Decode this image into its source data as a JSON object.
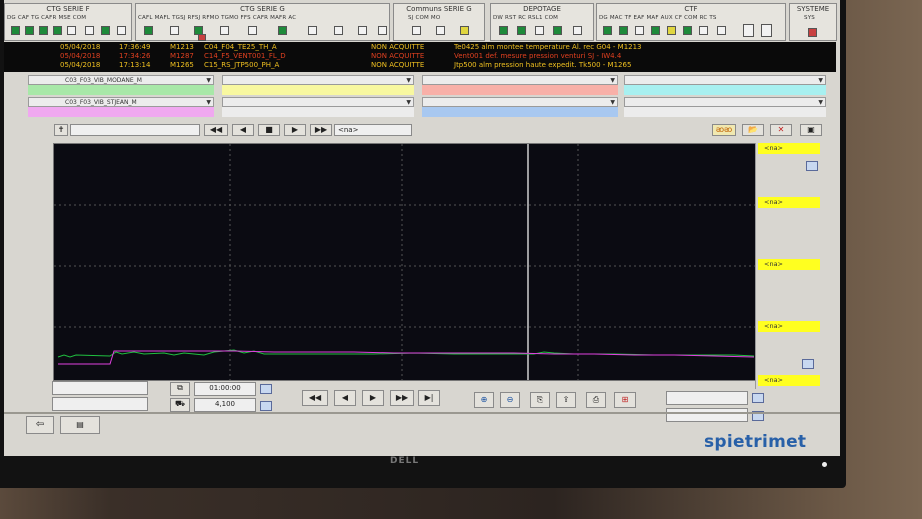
{
  "header": {
    "groups": [
      {
        "title": "CTG SERIE F",
        "labels": "DG CAF TG CAFR MSE COM"
      },
      {
        "title": "CTG SERIE G",
        "labels": "CAFL MAFL TGSJ RFSJ RFMO TGMO FFS CAFR MAFR AC"
      },
      {
        "title": "Communs SERIE G",
        "labels": "SJ   COM   MO"
      },
      {
        "title": "DEPOTAGE",
        "labels": "DW RST RC RSL1 COM"
      },
      {
        "title": "CTF",
        "labels": "DG MAC TF EAF MAF AUX CF COM RC TS"
      },
      {
        "title": "SYSTEME",
        "labels": "SYS"
      }
    ]
  },
  "alarms": [
    {
      "date": "05/04/2018",
      "time": "17:36:49",
      "code": "M1213",
      "tag": "C04_F04_TE25_TH_A",
      "status": "NON ACQUITTE",
      "message": "Te0425 alm montee temperature Al. rec G04 - M1213",
      "color": "#f0c020"
    },
    {
      "date": "05/04/2018",
      "time": "17:34:26",
      "code": "M1287",
      "tag": "C14_F5_VENT001_FL_D",
      "status": "NON ACQUITTE",
      "message": "Vent001 def. mesure pression venturi SJ - IW4.4",
      "color": "#e04020"
    },
    {
      "date": "05/04/2018",
      "time": "17:13:14",
      "code": "M1265",
      "tag": "C15_RS_JTP500_PH_A",
      "status": "NON ACQUITTE",
      "message": "Jtp500 alm pression haute expedit. Tk500 - M1265",
      "color": "#f0c020"
    }
  ],
  "selectors": {
    "sel1": "C03_F03_VIB_MODANE_M",
    "sel2": "C03_F03_VIB_STJEAN_M"
  },
  "toolbar": {
    "na_label": "<na>",
    "first": "◀◀",
    "prev": "◀",
    "stop": "■",
    "next": "▶",
    "last": "▶▶"
  },
  "right_panel": {
    "labels": [
      "<na>",
      "<na>",
      "<na>",
      "<na>",
      "<na>"
    ]
  },
  "bottom": {
    "duration": "01:00:00",
    "value": "4,100"
  },
  "logo": "spietrimet",
  "brand": "DELL"
}
